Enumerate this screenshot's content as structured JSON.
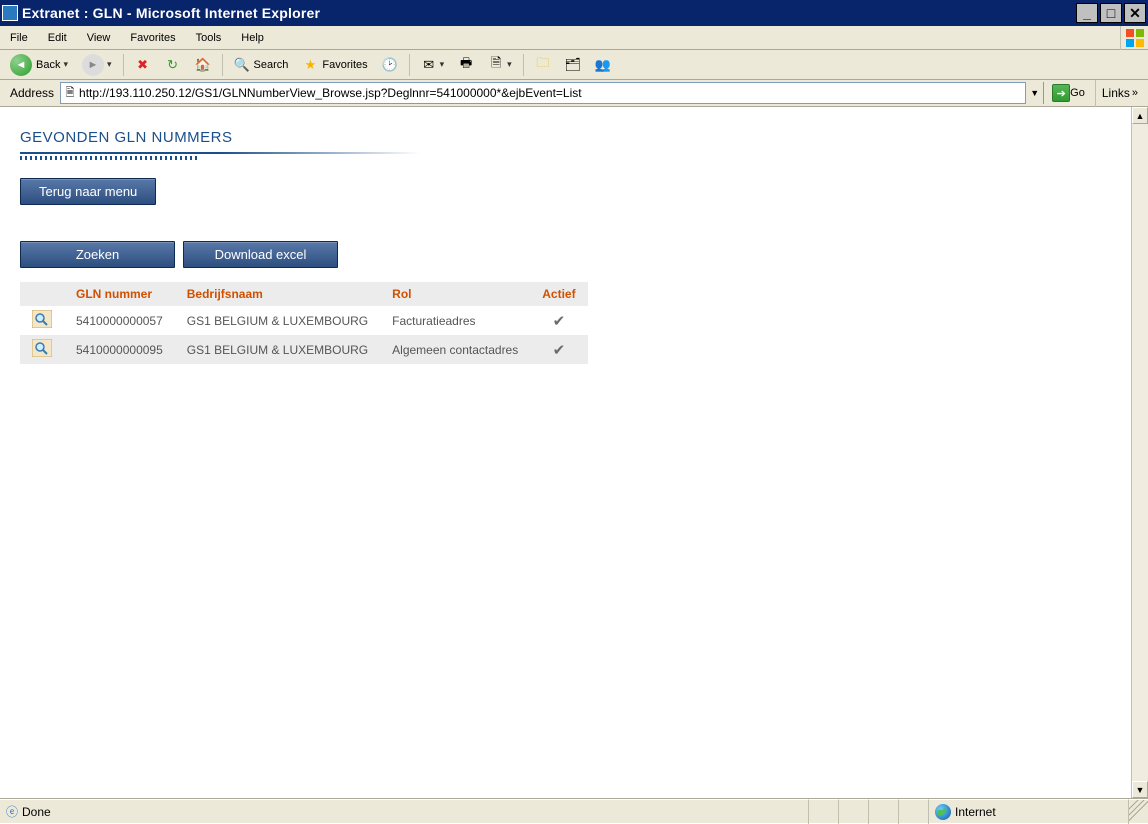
{
  "window": {
    "title": "Extranet : GLN - Microsoft Internet Explorer"
  },
  "menu": [
    "File",
    "Edit",
    "View",
    "Favorites",
    "Tools",
    "Help"
  ],
  "toolbar": {
    "back": "Back",
    "search": "Search",
    "favorites": "Favorites"
  },
  "address": {
    "label": "Address",
    "url": "http://193.110.250.12/GS1/GLNNumberView_Browse.jsp?Deglnnr=541000000*&ejbEvent=List",
    "go": "Go",
    "links": "Links"
  },
  "page": {
    "heading": "GEVONDEN GLN NUMMERS",
    "back_button": "Terug naar menu",
    "search_button": "Zoeken",
    "download_button": "Download excel",
    "columns": {
      "gln": "GLN nummer",
      "company": "Bedrijfsnaam",
      "role": "Rol",
      "active": "Actief"
    },
    "rows": [
      {
        "gln": "5410000000057",
        "company": "GS1 BELGIUM & LUXEMBOURG",
        "role": "Facturatieadres",
        "active": true
      },
      {
        "gln": "5410000000095",
        "company": "GS1 BELGIUM & LUXEMBOURG",
        "role": "Algemeen contactadres",
        "active": true
      }
    ]
  },
  "status": {
    "text": "Done",
    "zone": "Internet"
  }
}
